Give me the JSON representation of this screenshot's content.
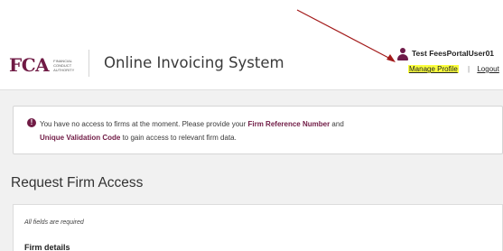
{
  "header": {
    "logo_mark": "FCA",
    "logo_text": "Financial Conduct Authority",
    "app_title": "Online Invoicing System",
    "user": {
      "name": "Test FeesPortalUser01",
      "icon": "user-icon"
    },
    "links": {
      "manage_profile": "Manage Profile",
      "separator": "|",
      "logout": "Logout"
    }
  },
  "alert": {
    "icon": "exclamation-icon",
    "text_1": "You have no access to firms at the moment. Please provide your ",
    "bold_1": "Firm Reference Number",
    "text_2": " and ",
    "bold_2": "Unique Validation Code",
    "text_3": " to gain access to relevant firm data."
  },
  "main": {
    "heading": "Request Firm Access",
    "required_note": "All fields are required",
    "section_title": "Firm details"
  },
  "colors": {
    "brand": "#701b45",
    "highlight": "#fbff3d",
    "annotation_arrow": "#a31a1a"
  }
}
